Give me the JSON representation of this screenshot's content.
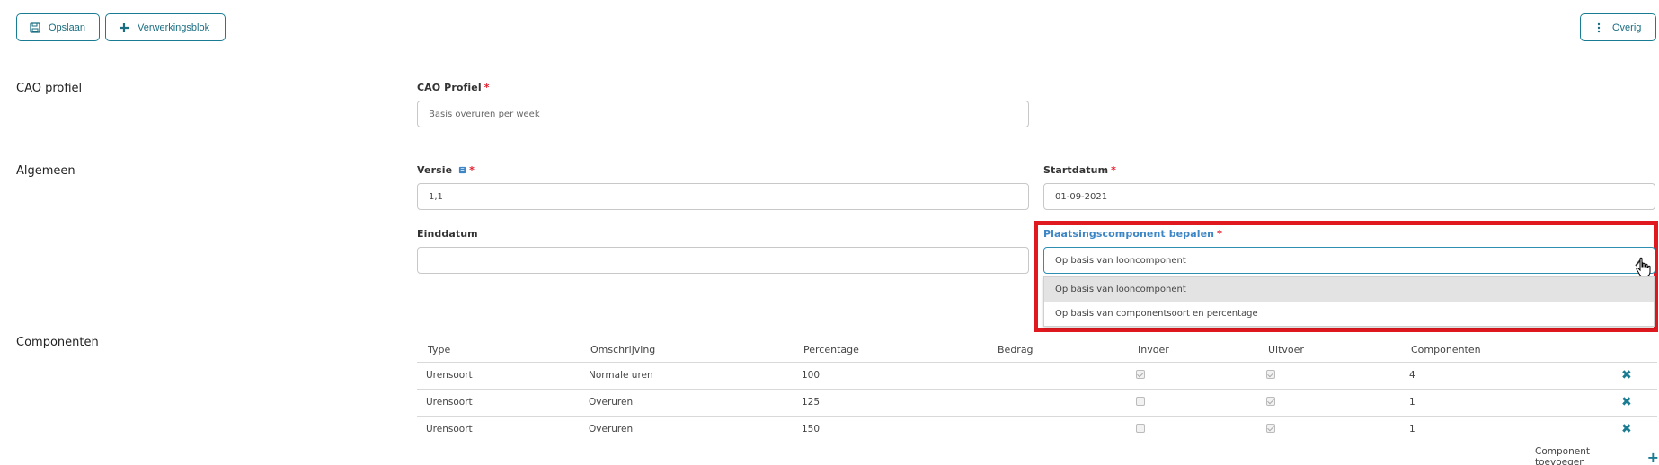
{
  "toolbar": {
    "save_label": "Opslaan",
    "block_label": "Verwerkingsblok",
    "other_label": "Overig"
  },
  "sections": {
    "cao": "CAO profiel",
    "algemeen": "Algemeen",
    "componenten": "Componenten"
  },
  "cao_profiel": {
    "label": "CAO Profiel",
    "required": "*",
    "value": "Basis overuren per week"
  },
  "versie": {
    "label": "Versie",
    "required": "*",
    "value": "1,1"
  },
  "startdatum": {
    "label": "Startdatum",
    "required": "*",
    "value": "01-09-2021"
  },
  "einddatum": {
    "label": "Einddatum",
    "value": ""
  },
  "plaatsing": {
    "label": "Plaatsingscomponent bepalen",
    "required": "*",
    "value": "Op basis van looncomponent",
    "options": [
      "Op basis van looncomponent",
      "Op basis van componentsoort en percentage"
    ]
  },
  "table": {
    "headers": [
      "Type",
      "Omschrijving",
      "Percentage",
      "Bedrag",
      "Invoer",
      "Uitvoer",
      "Componenten"
    ],
    "rows": [
      {
        "type": "Urensoort",
        "omschrijving": "Normale uren",
        "percentage": "100",
        "bedrag": "",
        "invoer": true,
        "uitvoer": true,
        "componenten": "4"
      },
      {
        "type": "Urensoort",
        "omschrijving": "Overuren",
        "percentage": "125",
        "bedrag": "",
        "invoer": false,
        "uitvoer": true,
        "componenten": "1"
      },
      {
        "type": "Urensoort",
        "omschrijving": "Overuren",
        "percentage": "150",
        "bedrag": "",
        "invoer": false,
        "uitvoer": true,
        "componenten": "1"
      }
    ]
  },
  "add_component_label": "Component toevoegen",
  "colors": {
    "accent": "#1a7c93",
    "required": "#e31a2b",
    "highlight": "#e0191f",
    "active_label": "#3d86c6"
  }
}
